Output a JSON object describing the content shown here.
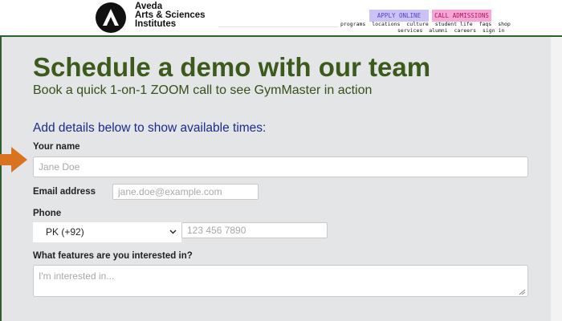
{
  "header": {
    "logo_lines": [
      "Aveda",
      "Arts & Sciences",
      "Institutes"
    ],
    "apply_label": "APPLY ONLINE",
    "call_label": "CALL ADMISSIONS",
    "nav_row1": [
      "programs",
      "locations",
      "culture",
      "student life",
      "faqs",
      "shop"
    ],
    "nav_row2": [
      "services",
      "alumni",
      "careers",
      "sign in"
    ]
  },
  "form": {
    "title": "Schedule a demo with our team",
    "subtitle": "Book a quick 1-on-1 ZOOM call to see GymMaster in action",
    "details_heading": "Add details below to show available times:",
    "name_label": "Your name",
    "name_placeholder": "Jane Doe",
    "email_label": "Email address",
    "email_placeholder": "jane.doe@example.com",
    "phone_label": "Phone",
    "country_code": "PK (+92)",
    "phone_placeholder": "123 456 7890",
    "features_label": "What features are you interested in?",
    "features_placeholder": "I'm interested in..."
  },
  "colors": {
    "title_green": "#3d5a1d",
    "heading_blue": "#1b2a8c",
    "arrow_orange": "#d9731f",
    "apply_bg": "#cbc2f5",
    "call_bg": "#f7a7d6",
    "frame_green": "#2f5f2a"
  },
  "icons": {
    "logo": "aveda-logo-icon",
    "arrow": "arrow-right-icon",
    "select": "chevron-down-icon"
  }
}
